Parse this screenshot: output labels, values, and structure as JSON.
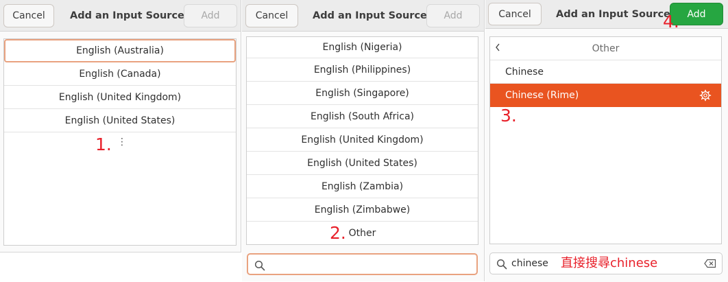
{
  "panels": [
    {
      "header": {
        "cancel_label": "Cancel",
        "title": "Add an Input Source",
        "add_label": "Add"
      },
      "languages": [
        "English (Australia)",
        "English (Canada)",
        "English (United Kingdom)",
        "English (United States)"
      ],
      "more_indicator": "⋮",
      "annotation": "1."
    },
    {
      "header": {
        "cancel_label": "Cancel",
        "title": "Add an Input Source",
        "add_label": "Add"
      },
      "languages": [
        "English (Nigeria)",
        "English (Philippines)",
        "English (Singapore)",
        "English (South Africa)",
        "English (United Kingdom)",
        "English (United States)",
        "English (Zambia)",
        "English (Zimbabwe)",
        "Other"
      ],
      "annotation": "2.",
      "search": {
        "value": ""
      }
    },
    {
      "header": {
        "cancel_label": "Cancel",
        "title": "Add an Input Source",
        "add_label": "Add"
      },
      "back_label": "Other",
      "items": [
        "Chinese",
        "Chinese (Rime)"
      ],
      "annotation_select": "3.",
      "annotation_add": "4.",
      "search": {
        "value": "chinese",
        "note": "直接搜尋chinese"
      }
    }
  ],
  "colors": {
    "accent": "#e95420",
    "add_enabled": "#26a641",
    "annotation": "#e8202a",
    "focus_ring": "#e9a27f"
  },
  "icons": [
    "search-icon",
    "gear-icon",
    "chevron-left-icon",
    "clear-icon",
    "more-icon"
  ]
}
